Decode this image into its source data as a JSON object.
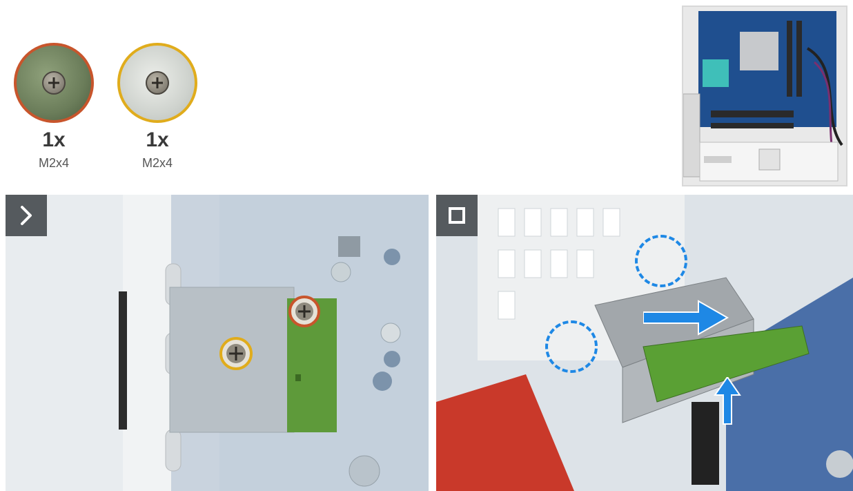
{
  "screws": [
    {
      "quantity": "1x",
      "size": "M2x4",
      "ring_color": "#c8552c"
    },
    {
      "quantity": "1x",
      "size": "M2x4",
      "ring_color": "#e0ac1c"
    }
  ],
  "steps": [
    {
      "icon": "chevron-right-icon"
    },
    {
      "icon": "square-stop-icon"
    }
  ],
  "colors": {
    "callout_red": "#c8552c",
    "callout_yellow": "#e0ac1c",
    "arrow_blue": "#1e88e5",
    "badge_gray": "#555a5e"
  }
}
